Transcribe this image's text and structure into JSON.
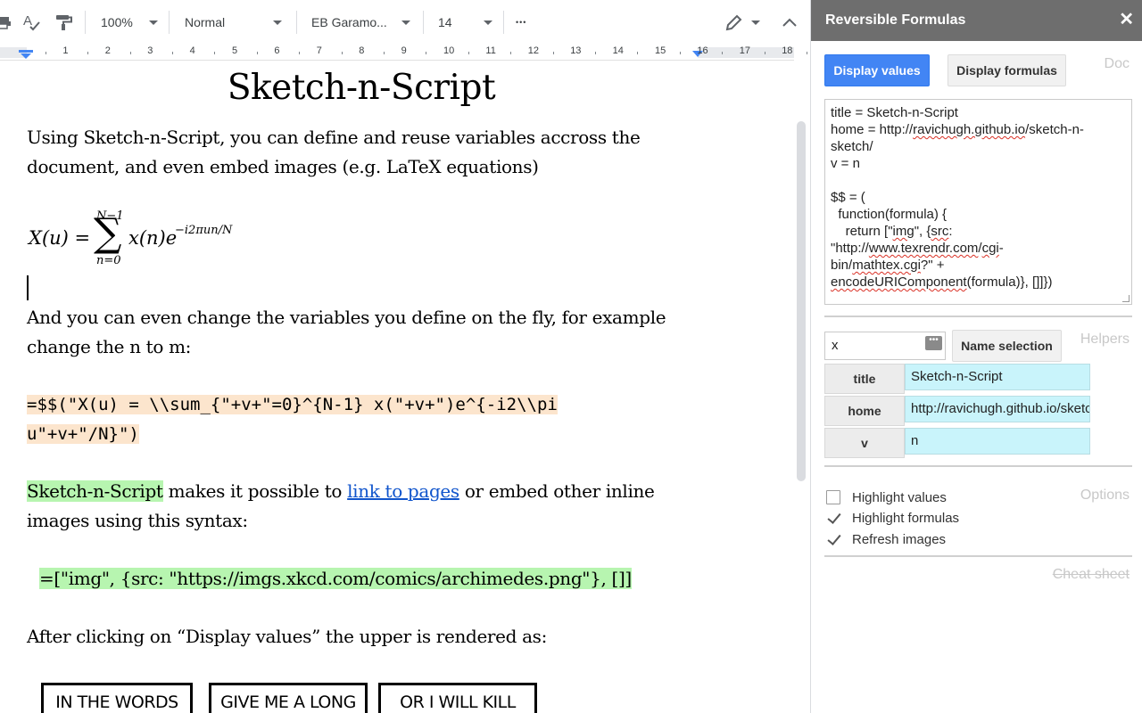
{
  "toolbar": {
    "zoom": "100%",
    "style": "Normal",
    "font": "EB Garamo...",
    "font_size": "14",
    "more": "•••"
  },
  "ruler": {
    "labels": [
      "1",
      "2",
      "3",
      "4",
      "5",
      "6",
      "7",
      "8",
      "9",
      "10",
      "11",
      "12",
      "13",
      "14",
      "15",
      "16",
      "17",
      "18"
    ]
  },
  "document": {
    "title": "Sketch-n-Script",
    "para1": "Using Sketch-n-Script, you can define and reuse variables accross the document, and even embed images (e.g. LaTeX equations)",
    "equation": {
      "lhs": "X(u) =",
      "sum": "∑",
      "upper": "N−1",
      "lower": "n=0",
      "term": "x(n)e",
      "exponent": "−i2πun/N"
    },
    "para2": "And you can even change the variables you define on the fly, for example change the n to m:",
    "code1_line1": "=$$(\"X(u) = \\\\sum_{\"+v+\"=0}^{N-1} x(\"+v+\")e^{-i2\\\\pi",
    "code1_line2": "u\"+v+\"/N}\")",
    "para3_hl": "Sketch-n-Script",
    "para3_a": " makes it  possible to ",
    "para3_link": "link to pages",
    "para3_b": " or embed other inline images using this syntax:",
    "code2": "=[\"img\", {src: \"https://imgs.xkcd.com/comics/archimedes.png\"}, []]",
    "para4": "After clicking on “Display values” the upper is rendered as:",
    "comic_panels": [
      "IN THE WORDS",
      "GIVE ME A LONG",
      "OR I WILL KILL"
    ]
  },
  "side_panel": {
    "title": "Reversible Formulas",
    "close": "✕",
    "display_values": "Display values",
    "display_formulas": "Display formulas",
    "doc_label": "Doc",
    "formula_lines": [
      "title = Sketch-n-Script",
      "home = http://",
      "ravichugh.github.io",
      "/sketch-n-sketch/",
      "v = n",
      "",
      "$$ = (",
      "  function(formula) {",
      "    return [\"",
      "img",
      "\", {",
      "src",
      ":",
      "\"http://",
      "www.texrendr.com",
      "/",
      "cgi",
      "-",
      "bin",
      "/",
      "mathtex.cgi",
      "?\" +",
      "encodeURIComponent",
      "(formula)}, []]})"
    ],
    "name_input": "x",
    "name_selection": "Name selection",
    "helpers_label": "Helpers",
    "variables": [
      {
        "key": "title",
        "value": "Sketch-n-Script"
      },
      {
        "key": "home",
        "value": "http://ravichugh.github.io/sketch-n-sketch/"
      },
      {
        "key": "v",
        "value": "n"
      }
    ],
    "options_label": "Options",
    "options": [
      {
        "label": "Highlight values",
        "checked": false
      },
      {
        "label": "Highlight formulas",
        "checked": true
      },
      {
        "label": "Refresh images",
        "checked": true
      }
    ],
    "cheat_sheet": "Cheat sheet"
  },
  "colors": {
    "accent": "#4285f4",
    "header": "#6e6e6e",
    "highlight_orange": "#fce5cd",
    "highlight_green": "#b7f5b0",
    "var_value_bg": "#c9f4fb",
    "link": "#1155cc"
  }
}
